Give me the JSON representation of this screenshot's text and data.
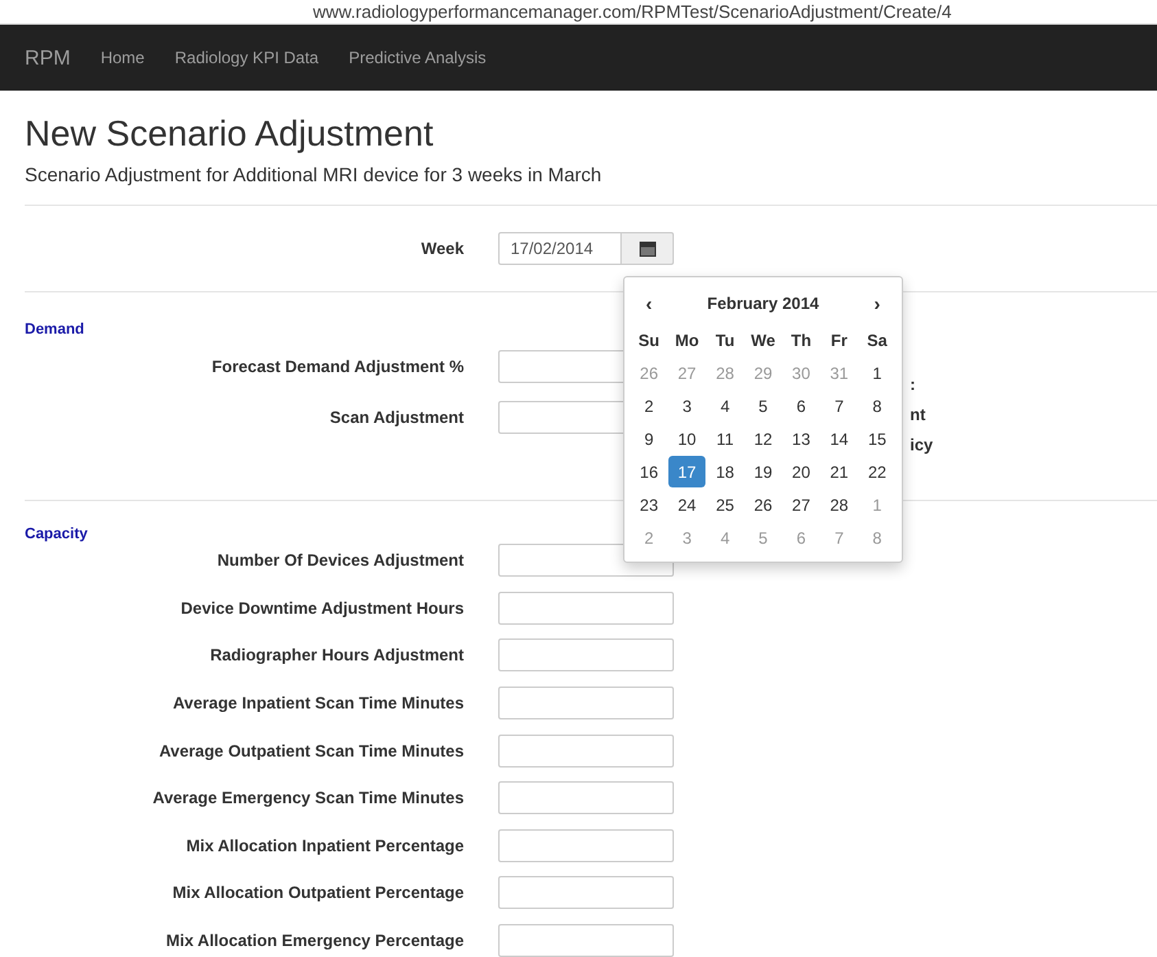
{
  "address_bar": {
    "url": "www.radiologyperformancemanager.com/RPMTest/ScenarioAdjustment/Create/4"
  },
  "navbar": {
    "brand": "RPM",
    "items": [
      {
        "label": "Home"
      },
      {
        "label": "Radiology KPI Data"
      },
      {
        "label": "Predictive Analysis"
      }
    ]
  },
  "heading": "New Scenario Adjustment",
  "subtitle": "Scenario Adjustment for Additional MRI device for 3 weeks in March",
  "week": {
    "label": "Week",
    "value": "17/02/2014"
  },
  "datepicker": {
    "prev": "‹",
    "title": "February 2014",
    "next": "›",
    "weekdays": [
      "Su",
      "Mo",
      "Tu",
      "We",
      "Th",
      "Fr",
      "Sa"
    ],
    "weeks": [
      [
        {
          "day": "26",
          "other_month": true,
          "selected": false
        },
        {
          "day": "27",
          "other_month": true,
          "selected": false
        },
        {
          "day": "28",
          "other_month": true,
          "selected": false
        },
        {
          "day": "29",
          "other_month": true,
          "selected": false
        },
        {
          "day": "30",
          "other_month": true,
          "selected": false
        },
        {
          "day": "31",
          "other_month": true,
          "selected": false
        },
        {
          "day": "1",
          "other_month": false,
          "selected": false
        }
      ],
      [
        {
          "day": "2",
          "other_month": false,
          "selected": false
        },
        {
          "day": "3",
          "other_month": false,
          "selected": false
        },
        {
          "day": "4",
          "other_month": false,
          "selected": false
        },
        {
          "day": "5",
          "other_month": false,
          "selected": false
        },
        {
          "day": "6",
          "other_month": false,
          "selected": false
        },
        {
          "day": "7",
          "other_month": false,
          "selected": false
        },
        {
          "day": "8",
          "other_month": false,
          "selected": false
        }
      ],
      [
        {
          "day": "9",
          "other_month": false,
          "selected": false
        },
        {
          "day": "10",
          "other_month": false,
          "selected": false
        },
        {
          "day": "11",
          "other_month": false,
          "selected": false
        },
        {
          "day": "12",
          "other_month": false,
          "selected": false
        },
        {
          "day": "13",
          "other_month": false,
          "selected": false
        },
        {
          "day": "14",
          "other_month": false,
          "selected": false
        },
        {
          "day": "15",
          "other_month": false,
          "selected": false
        }
      ],
      [
        {
          "day": "16",
          "other_month": false,
          "selected": false
        },
        {
          "day": "17",
          "other_month": false,
          "selected": true
        },
        {
          "day": "18",
          "other_month": false,
          "selected": false
        },
        {
          "day": "19",
          "other_month": false,
          "selected": false
        },
        {
          "day": "20",
          "other_month": false,
          "selected": false
        },
        {
          "day": "21",
          "other_month": false,
          "selected": false
        },
        {
          "day": "22",
          "other_month": false,
          "selected": false
        }
      ],
      [
        {
          "day": "23",
          "other_month": false,
          "selected": false
        },
        {
          "day": "24",
          "other_month": false,
          "selected": false
        },
        {
          "day": "25",
          "other_month": false,
          "selected": false
        },
        {
          "day": "26",
          "other_month": false,
          "selected": false
        },
        {
          "day": "27",
          "other_month": false,
          "selected": false
        },
        {
          "day": "28",
          "other_month": false,
          "selected": false
        },
        {
          "day": "1",
          "other_month": true,
          "selected": false
        }
      ],
      [
        {
          "day": "2",
          "other_month": true,
          "selected": false
        },
        {
          "day": "3",
          "other_month": true,
          "selected": false
        },
        {
          "day": "4",
          "other_month": true,
          "selected": false
        },
        {
          "day": "5",
          "other_month": true,
          "selected": false
        },
        {
          "day": "6",
          "other_month": true,
          "selected": false
        },
        {
          "day": "7",
          "other_month": true,
          "selected": false
        },
        {
          "day": "8",
          "other_month": true,
          "selected": false
        }
      ]
    ]
  },
  "sections": [
    {
      "title": "Demand",
      "fields": [
        {
          "label": "Forecast Demand Adjustment %"
        },
        {
          "label": "Scan Adjustment"
        }
      ],
      "side_notes": [
        ":",
        "nt",
        "icy"
      ]
    },
    {
      "title": "Capacity",
      "fields": [
        {
          "label": "Number Of Devices Adjustment"
        },
        {
          "label": "Device Downtime Adjustment Hours"
        },
        {
          "label": "Radiographer Hours Adjustment"
        },
        {
          "label": "Average Inpatient Scan Time Minutes"
        },
        {
          "label": "Average Outpatient Scan Time Minutes"
        },
        {
          "label": "Average Emergency Scan Time Minutes"
        },
        {
          "label": "Mix Allocation Inpatient Percentage"
        },
        {
          "label": "Mix Allocation Outpatient Percentage"
        },
        {
          "label": "Mix Allocation Emergency Percentage"
        }
      ]
    }
  ]
}
